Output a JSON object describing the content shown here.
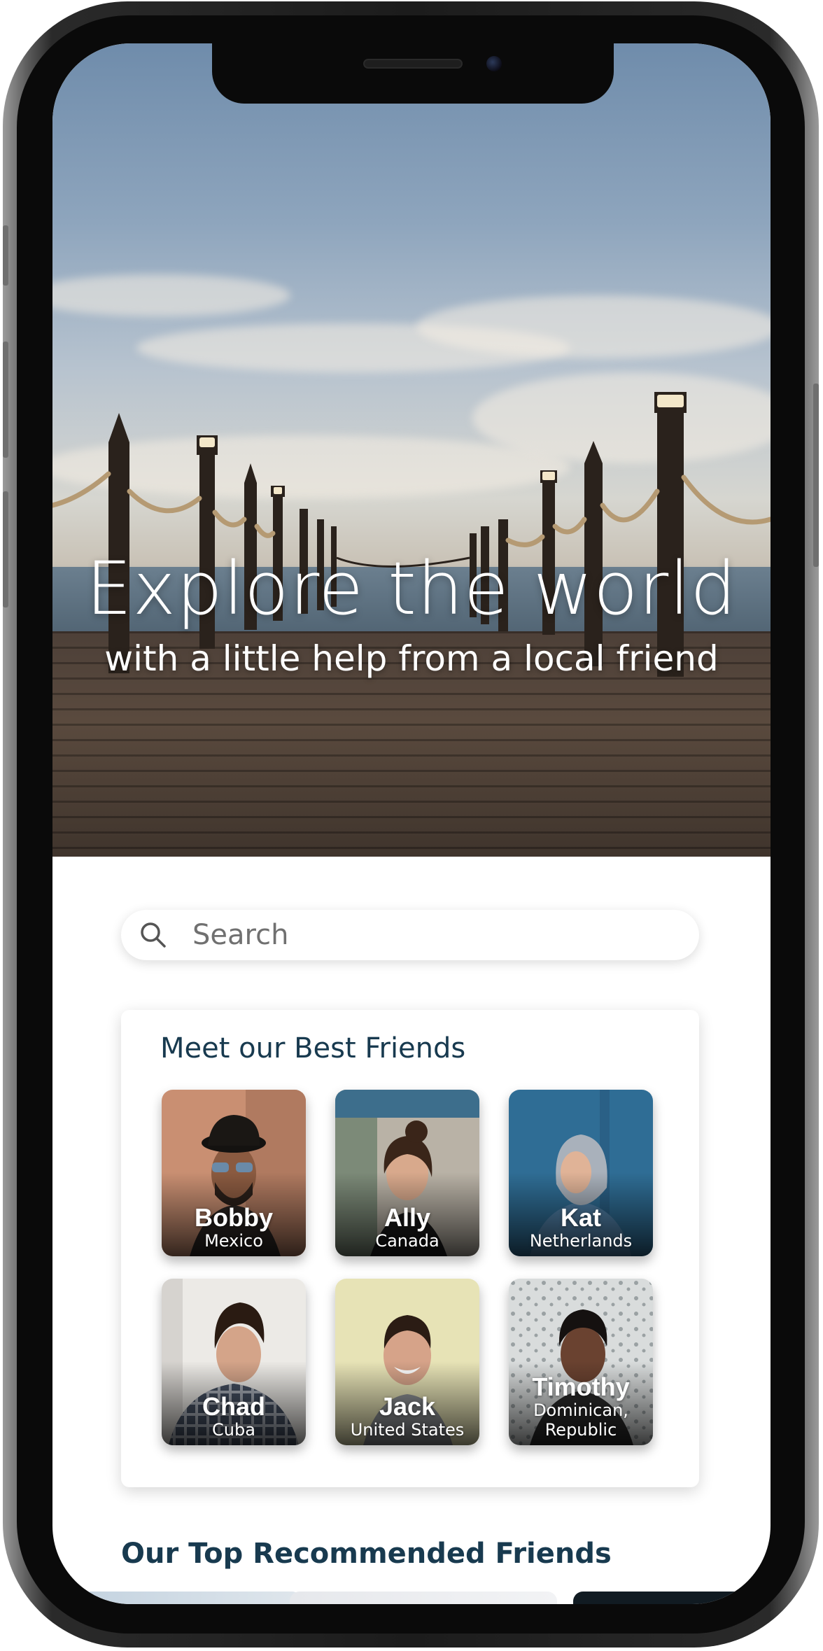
{
  "hero": {
    "title": "Explore the world",
    "subtitle": "with a little help from a local friend"
  },
  "search": {
    "placeholder": "Search",
    "icon": "magnifier"
  },
  "best_friends": {
    "title": "Meet our Best Friends",
    "friends": [
      {
        "name": "Bobby",
        "country": "Mexico"
      },
      {
        "name": "Ally",
        "country": "Canada"
      },
      {
        "name": "Kat",
        "country": "Netherlands"
      },
      {
        "name": "Chad",
        "country": "Cuba"
      },
      {
        "name": "Jack",
        "country": "United States"
      },
      {
        "name": "Timothy",
        "country": "Dominican, Republic"
      }
    ]
  },
  "recommended": {
    "title": "Our Top Recommended Friends"
  },
  "colors": {
    "heading": "#183a4f",
    "search_text": "#707070",
    "card_bg": "#ffffff"
  }
}
